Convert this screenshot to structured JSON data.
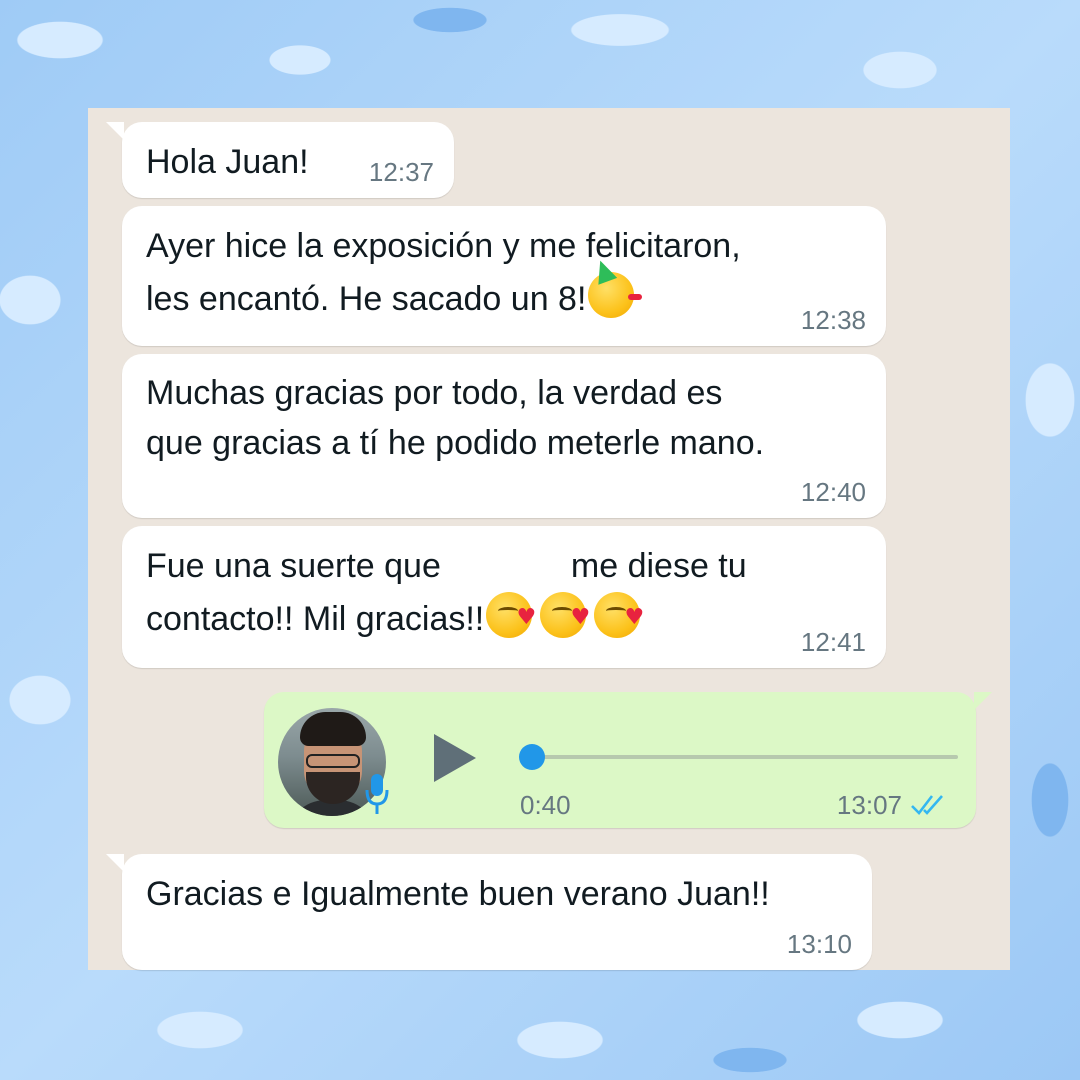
{
  "messages": [
    {
      "text": "Hola Juan!",
      "time": "12:37"
    },
    {
      "text": "Ayer hice la exposición y me felicitaron,\nles encantó. He sacado un 8!",
      "emoji": "partying-face",
      "time": "12:38"
    },
    {
      "text": "Muchas gracias por todo, la verdad es\nque gracias a tí he podido meterle mano.",
      "time": "12:40"
    },
    {
      "line1a": "Fue una suerte que",
      "line1b": "me diese tu",
      "line2": "contacto!! Mil gracias!!",
      "emoji": "face-blowing-a-kiss",
      "emoji_count": 3,
      "time": "12:41"
    }
  ],
  "voice_note": {
    "duration": "0:40",
    "time": "13:07",
    "status": "read-double-check",
    "progress": 0,
    "avatar": "sender-avatar",
    "colors": {
      "bubble": "#dcf8c6",
      "knob": "#2197e8",
      "check": "#34b7f1"
    }
  },
  "reply": {
    "text": "Gracias e Igualmente buen verano Juan!!",
    "time": "13:10"
  },
  "colors": {
    "chat_bg": "#ece5dd",
    "incoming_bubble": "#ffffff",
    "page_bg": "#a9d0f7"
  }
}
